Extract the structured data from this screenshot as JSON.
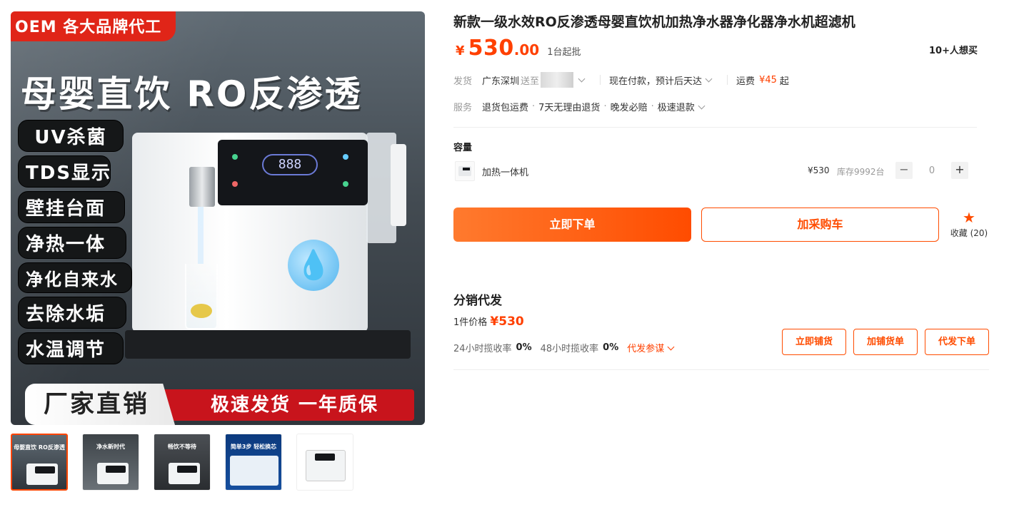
{
  "gallery": {
    "main": {
      "oem_tag": "OEM 各大品牌代工",
      "headline": "母婴直饮 RO反渗透",
      "features": [
        "UV杀菌",
        "TDS显示",
        "壁挂台面",
        "净热一体",
        "净化自来水",
        "去除水垢",
        "水温调节"
      ],
      "display_digits": "888",
      "banner_left": "厂家直销",
      "banner_right": "极速发货 一年质保"
    },
    "thumbnails": [
      {
        "caption": "母婴直饮 RO反渗透"
      },
      {
        "caption": "净水新时代"
      },
      {
        "caption": "畅饮不等待"
      },
      {
        "caption": "简单3步 轻松换芯"
      },
      {
        "caption": ""
      }
    ]
  },
  "product": {
    "title": "新款一级水效RO反渗透母婴直饮机加热净水器净化器净水机超滤机",
    "price_symbol": "¥",
    "price_int": "530",
    "price_dec": ".00",
    "moq": "1台起批",
    "want_count": "10+人想买"
  },
  "shipping": {
    "label": "发货",
    "origin": "广东深圳",
    "to_label": "送至",
    "payment_info": "现在付款，预计后天达",
    "fee_label": "运费",
    "fee_value": "¥45",
    "fee_suffix": "起"
  },
  "service": {
    "label": "服务",
    "items": [
      "退货包运费",
      "7天无理由退货",
      "晚发必赔",
      "极速退款"
    ],
    "separator": "·"
  },
  "capacity": {
    "label": "容量",
    "sku_name": "加热一体机",
    "sku_price": "¥530",
    "sku_stock": "库存9992台",
    "quantity": "0",
    "minus": "−",
    "plus": "+"
  },
  "actions": {
    "buy_now": "立即下单",
    "add_cart": "加采购车",
    "favorite": "收藏 (20)"
  },
  "distribution": {
    "title": "分销代发",
    "price_label": "1件价格",
    "price_value": "¥530",
    "rate_24_label": "24小时揽收率",
    "rate_24_value": "0%",
    "rate_48_label": "48小时揽收率",
    "rate_48_value": "0%",
    "reference_link": "代发参谋",
    "btn_list": "立即铺货",
    "btn_add": "加铺货单",
    "btn_order": "代发下单"
  },
  "colors": {
    "accent": "#ff4c00",
    "price": "#ff4000",
    "oem_red": "#e02518"
  },
  "icons": [
    "chevron-down-icon",
    "star-icon",
    "water-drop-icon"
  ]
}
